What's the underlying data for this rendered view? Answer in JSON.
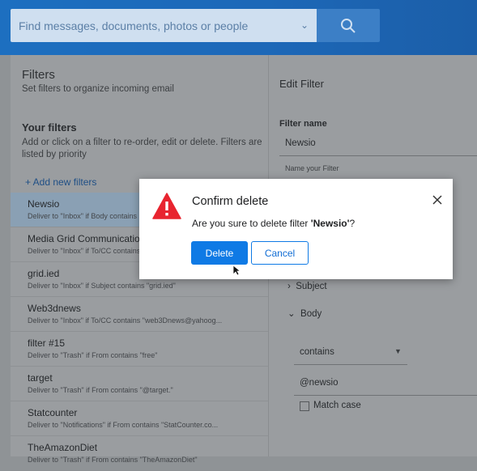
{
  "search": {
    "placeholder": "Find messages, documents, photos or people",
    "icon": "search-icon"
  },
  "filters_panel": {
    "title": "Filters",
    "subtitle": "Set filters to organize incoming email",
    "section_title": "Your filters",
    "section_desc": "Add or click on a filter to re-order, edit or delete. Filters are listed by priority",
    "add_label": "+ Add new filters",
    "items": [
      {
        "name": "Newsio",
        "desc": "Deliver to \"Inbox\" if Body contains"
      },
      {
        "name": "Media Grid Communication",
        "desc": "Deliver to \"Inbox\" if To/CC contains"
      },
      {
        "name": "grid.ied",
        "desc": "Deliver to \"Inbox\" if Subject contains \"grid.ied\""
      },
      {
        "name": "Web3dnews",
        "desc": "Deliver to \"Inbox\" if To/CC contains \"web3Dnews@yahoog..."
      },
      {
        "name": "filter #15",
        "desc": "Deliver to \"Trash\" if From contains \"free\""
      },
      {
        "name": "target",
        "desc": "Deliver to \"Trash\" if From contains \"@target.\""
      },
      {
        "name": "Statcounter",
        "desc": "Deliver to \"Notifications\" if From contains \"StatCounter.co..."
      },
      {
        "name": "TheAmazonDiet",
        "desc": "Deliver to \"Trash\" if From contains \"TheAmazonDiet\""
      }
    ]
  },
  "edit_filter": {
    "title": "Edit Filter",
    "name_label": "Filter name",
    "name_value": "Newsio",
    "name_hint": "Name your Filter",
    "subject_label": "Subject",
    "body_label": "Body",
    "contains_value": "contains",
    "match_value": "@newsio",
    "match_case_label": "Match case"
  },
  "dialog": {
    "title": "Confirm delete",
    "message_prefix": "Are you sure to delete filter ",
    "message_name": "'Newsio'",
    "message_suffix": "?",
    "delete_label": "Delete",
    "cancel_label": "Cancel"
  },
  "colors": {
    "accent": "#0f7ae5",
    "warning": "#e8242f",
    "topbar": "#1d6fc0"
  }
}
